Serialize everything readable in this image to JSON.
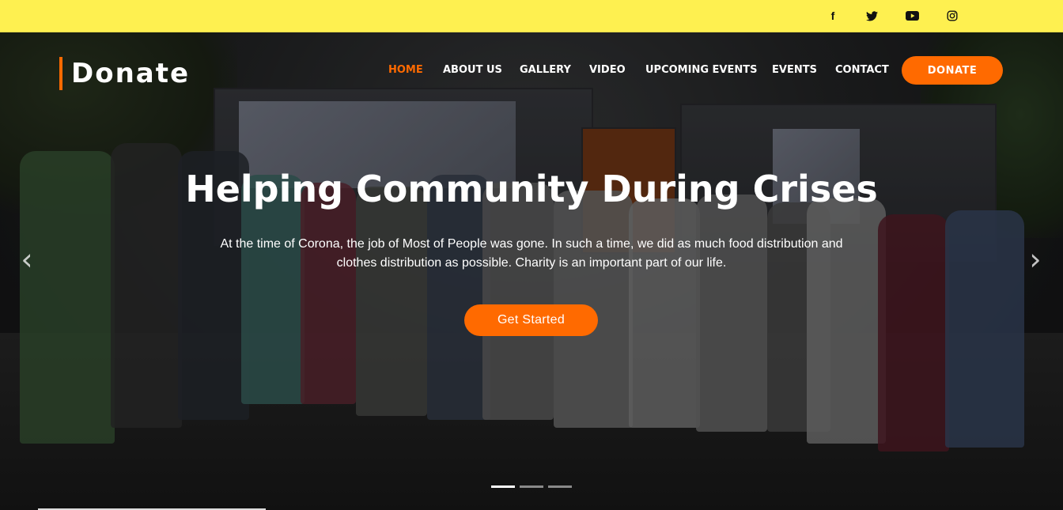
{
  "topbar": {
    "bg_color": "#fef050",
    "social": [
      {
        "icon": "facebook-icon",
        "glyph": "f"
      },
      {
        "icon": "twitter-icon",
        "glyph": "🐦"
      },
      {
        "icon": "youtube-icon",
        "glyph": "▶"
      },
      {
        "icon": "instagram-icon",
        "glyph": "◎"
      }
    ]
  },
  "brand": {
    "name": "Donate",
    "accent": "#ff6a00"
  },
  "nav": {
    "items": [
      "HOME",
      "ABOUT US",
      "GALLERY",
      "VIDEO",
      "UPCOMING EVENTS",
      "EVENTS",
      "CONTACT"
    ],
    "active": "HOME",
    "donate_label": "DONATE"
  },
  "hero": {
    "title": "Helping Community During Crises",
    "description": "At the time of Corona, the job of Most of People was gone. In such a time, we did as much food distribution and clothes distribution as possible. Charity is an important part of our life.",
    "cta_label": "Get Started",
    "prev_glyph": "‹",
    "next_glyph": "›",
    "slide_count": 3,
    "active_slide": 1
  }
}
